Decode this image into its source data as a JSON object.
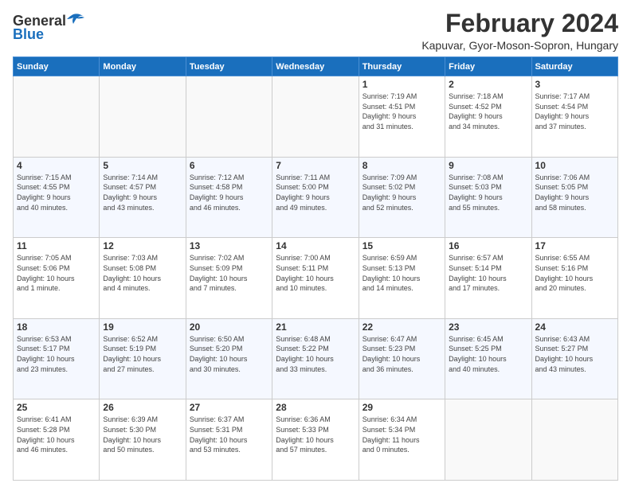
{
  "header": {
    "logo_general": "General",
    "logo_blue": "Blue",
    "month_year": "February 2024",
    "location": "Kapuvar, Gyor-Moson-Sopron, Hungary"
  },
  "days_of_week": [
    "Sunday",
    "Monday",
    "Tuesday",
    "Wednesday",
    "Thursday",
    "Friday",
    "Saturday"
  ],
  "weeks": [
    {
      "days": [
        {
          "number": "",
          "info": ""
        },
        {
          "number": "",
          "info": ""
        },
        {
          "number": "",
          "info": ""
        },
        {
          "number": "",
          "info": ""
        },
        {
          "number": "1",
          "info": "Sunrise: 7:19 AM\nSunset: 4:51 PM\nDaylight: 9 hours\nand 31 minutes."
        },
        {
          "number": "2",
          "info": "Sunrise: 7:18 AM\nSunset: 4:52 PM\nDaylight: 9 hours\nand 34 minutes."
        },
        {
          "number": "3",
          "info": "Sunrise: 7:17 AM\nSunset: 4:54 PM\nDaylight: 9 hours\nand 37 minutes."
        }
      ]
    },
    {
      "days": [
        {
          "number": "4",
          "info": "Sunrise: 7:15 AM\nSunset: 4:55 PM\nDaylight: 9 hours\nand 40 minutes."
        },
        {
          "number": "5",
          "info": "Sunrise: 7:14 AM\nSunset: 4:57 PM\nDaylight: 9 hours\nand 43 minutes."
        },
        {
          "number": "6",
          "info": "Sunrise: 7:12 AM\nSunset: 4:58 PM\nDaylight: 9 hours\nand 46 minutes."
        },
        {
          "number": "7",
          "info": "Sunrise: 7:11 AM\nSunset: 5:00 PM\nDaylight: 9 hours\nand 49 minutes."
        },
        {
          "number": "8",
          "info": "Sunrise: 7:09 AM\nSunset: 5:02 PM\nDaylight: 9 hours\nand 52 minutes."
        },
        {
          "number": "9",
          "info": "Sunrise: 7:08 AM\nSunset: 5:03 PM\nDaylight: 9 hours\nand 55 minutes."
        },
        {
          "number": "10",
          "info": "Sunrise: 7:06 AM\nSunset: 5:05 PM\nDaylight: 9 hours\nand 58 minutes."
        }
      ]
    },
    {
      "days": [
        {
          "number": "11",
          "info": "Sunrise: 7:05 AM\nSunset: 5:06 PM\nDaylight: 10 hours\nand 1 minute."
        },
        {
          "number": "12",
          "info": "Sunrise: 7:03 AM\nSunset: 5:08 PM\nDaylight: 10 hours\nand 4 minutes."
        },
        {
          "number": "13",
          "info": "Sunrise: 7:02 AM\nSunset: 5:09 PM\nDaylight: 10 hours\nand 7 minutes."
        },
        {
          "number": "14",
          "info": "Sunrise: 7:00 AM\nSunset: 5:11 PM\nDaylight: 10 hours\nand 10 minutes."
        },
        {
          "number": "15",
          "info": "Sunrise: 6:59 AM\nSunset: 5:13 PM\nDaylight: 10 hours\nand 14 minutes."
        },
        {
          "number": "16",
          "info": "Sunrise: 6:57 AM\nSunset: 5:14 PM\nDaylight: 10 hours\nand 17 minutes."
        },
        {
          "number": "17",
          "info": "Sunrise: 6:55 AM\nSunset: 5:16 PM\nDaylight: 10 hours\nand 20 minutes."
        }
      ]
    },
    {
      "days": [
        {
          "number": "18",
          "info": "Sunrise: 6:53 AM\nSunset: 5:17 PM\nDaylight: 10 hours\nand 23 minutes."
        },
        {
          "number": "19",
          "info": "Sunrise: 6:52 AM\nSunset: 5:19 PM\nDaylight: 10 hours\nand 27 minutes."
        },
        {
          "number": "20",
          "info": "Sunrise: 6:50 AM\nSunset: 5:20 PM\nDaylight: 10 hours\nand 30 minutes."
        },
        {
          "number": "21",
          "info": "Sunrise: 6:48 AM\nSunset: 5:22 PM\nDaylight: 10 hours\nand 33 minutes."
        },
        {
          "number": "22",
          "info": "Sunrise: 6:47 AM\nSunset: 5:23 PM\nDaylight: 10 hours\nand 36 minutes."
        },
        {
          "number": "23",
          "info": "Sunrise: 6:45 AM\nSunset: 5:25 PM\nDaylight: 10 hours\nand 40 minutes."
        },
        {
          "number": "24",
          "info": "Sunrise: 6:43 AM\nSunset: 5:27 PM\nDaylight: 10 hours\nand 43 minutes."
        }
      ]
    },
    {
      "days": [
        {
          "number": "25",
          "info": "Sunrise: 6:41 AM\nSunset: 5:28 PM\nDaylight: 10 hours\nand 46 minutes."
        },
        {
          "number": "26",
          "info": "Sunrise: 6:39 AM\nSunset: 5:30 PM\nDaylight: 10 hours\nand 50 minutes."
        },
        {
          "number": "27",
          "info": "Sunrise: 6:37 AM\nSunset: 5:31 PM\nDaylight: 10 hours\nand 53 minutes."
        },
        {
          "number": "28",
          "info": "Sunrise: 6:36 AM\nSunset: 5:33 PM\nDaylight: 10 hours\nand 57 minutes."
        },
        {
          "number": "29",
          "info": "Sunrise: 6:34 AM\nSunset: 5:34 PM\nDaylight: 11 hours\nand 0 minutes."
        },
        {
          "number": "",
          "info": ""
        },
        {
          "number": "",
          "info": ""
        }
      ]
    }
  ]
}
